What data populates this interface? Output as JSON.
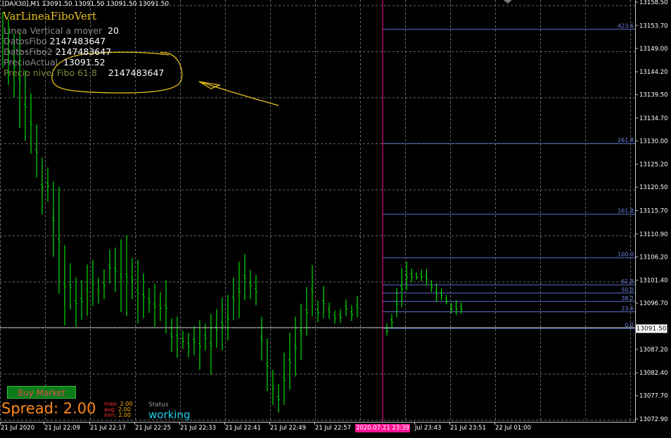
{
  "header": {
    "symbol_line": "[DAX30],M1  13091.50 13091.50 13091.50 13091.50"
  },
  "indicator": {
    "title": "VarLineaFiboVert",
    "rows": [
      {
        "label": "Linea Vertical a mover",
        "value": "20"
      },
      {
        "label": "DatosFibo",
        "value": "2147483647"
      },
      {
        "label": "DatosFibo2",
        "value": "2147483647"
      },
      {
        "label": "PrecioActual",
        "value": "13091.52"
      },
      {
        "label": "Precio nivel Fibo 61.8",
        "value": "2147483647"
      }
    ]
  },
  "panel": {
    "buy_button": "Buy Market",
    "spread_label": "Spread: 2.00",
    "max_label": "max:",
    "max_value": "2.00",
    "avg_label": "avg:",
    "avg_value": "2.00",
    "min_label": "min:",
    "min_value": "2.00",
    "status_label": "Status",
    "status_value": "working"
  },
  "axis": {
    "price_ticks": [
      "13158.50",
      "13153.70",
      "13149.00",
      "13144.20",
      "13139.50",
      "13134.70",
      "13130.00",
      "13125.20",
      "13120.50",
      "13115.70",
      "13110.90",
      "13106.20",
      "13101.40",
      "13096.70",
      "13091.50",
      "13087.20",
      "13082.40",
      "13077.70",
      "13072.90"
    ],
    "current_price": "13091.50",
    "time_ticks": [
      "21 Jul 2020",
      "21 Jul 22:09",
      "21 Jul 22:17",
      "21 Jul 22:25",
      "21 Jul 22:33",
      "21 Jul 22:41",
      "21 Jul 22:49",
      "21 Jul 22:57",
      "Jul 23:43",
      "21 Jul 23:51",
      "22 Jul 01:00"
    ],
    "highlight_time": "2020.07.21 23:39"
  },
  "fibo": {
    "levels": [
      "423.6",
      "261.8",
      "161.8",
      "100.0",
      "61.8",
      "50.0",
      "38.2",
      "23.6",
      "0.0"
    ],
    "line_color": "#5a6fc8",
    "label_color": "#6f86e6"
  },
  "colors": {
    "candle": "#00e000",
    "grid": "#6a6a6a",
    "vline": "#ff1493",
    "annotation": "#e7c21d"
  },
  "chart_data": {
    "type": "candlestick",
    "ylim": [
      13072.9,
      13158.5
    ],
    "bars": [
      {
        "t": "21 Jul 22:02",
        "h": 13156.5,
        "l": 13145.0
      },
      {
        "t": "21 Jul 22:03",
        "h": 13155.0,
        "l": 13141.5
      },
      {
        "t": "21 Jul 22:04",
        "h": 13152.0,
        "l": 13139.0
      },
      {
        "t": "21 Jul 22:05",
        "h": 13152.3,
        "l": 13132.6
      },
      {
        "t": "21 Jul 22:06",
        "h": 13144.5,
        "l": 13130.0
      },
      {
        "t": "21 Jul 22:07",
        "h": 13139.8,
        "l": 13127.4
      },
      {
        "t": "21 Jul 22:08",
        "h": 13133.4,
        "l": 13122.5
      },
      {
        "t": "21 Jul 22:09",
        "h": 13126.6,
        "l": 13114.9
      },
      {
        "t": "21 Jul 22:10",
        "h": 13124.6,
        "l": 13117.5
      },
      {
        "t": "21 Jul 22:11",
        "h": 13121.7,
        "l": 13106.2
      },
      {
        "t": "21 Jul 22:12",
        "h": 13120.6,
        "l": 13098.6
      },
      {
        "t": "21 Jul 22:13",
        "h": 13108.6,
        "l": 13092.1
      },
      {
        "t": "21 Jul 22:14",
        "h": 13104.9,
        "l": 13095.4
      },
      {
        "t": "21 Jul 22:15",
        "h": 13102.0,
        "l": 13091.8
      },
      {
        "t": "21 Jul 22:16",
        "h": 13101.4,
        "l": 13093.3
      },
      {
        "t": "21 Jul 22:17",
        "h": 13104.6,
        "l": 13094.1
      },
      {
        "t": "21 Jul 22:18",
        "h": 13105.6,
        "l": 13096.1
      },
      {
        "t": "21 Jul 22:19",
        "h": 13102.0,
        "l": 13096.6
      },
      {
        "t": "21 Jul 22:20",
        "h": 13103.6,
        "l": 13097.5
      },
      {
        "t": "21 Jul 22:21",
        "h": 13107.7,
        "l": 13100.7
      },
      {
        "t": "21 Jul 22:22",
        "h": 13108.1,
        "l": 13099.0
      },
      {
        "t": "21 Jul 22:23",
        "h": 13109.8,
        "l": 13094.9
      },
      {
        "t": "21 Jul 22:24",
        "h": 13110.6,
        "l": 13094.1
      },
      {
        "t": "21 Jul 22:25",
        "h": 13106.0,
        "l": 13097.5
      },
      {
        "t": "21 Jul 22:26",
        "h": 13105.6,
        "l": 13092.5
      },
      {
        "t": "21 Jul 22:27",
        "h": 13102.8,
        "l": 13093.6
      },
      {
        "t": "21 Jul 22:28",
        "h": 13099.8,
        "l": 13094.7
      },
      {
        "t": "21 Jul 22:29",
        "h": 13100.7,
        "l": 13091.8
      },
      {
        "t": "21 Jul 22:30",
        "h": 13098.9,
        "l": 13093.0
      },
      {
        "t": "21 Jul 22:31",
        "h": 13101.4,
        "l": 13090.5
      },
      {
        "t": "21 Jul 22:32",
        "h": 13093.5,
        "l": 13086.7
      },
      {
        "t": "21 Jul 22:33",
        "h": 13093.9,
        "l": 13085.5
      },
      {
        "t": "21 Jul 22:34",
        "h": 13091.0,
        "l": 13087.3
      },
      {
        "t": "21 Jul 22:35",
        "h": 13090.6,
        "l": 13085.6
      },
      {
        "t": "21 Jul 22:36",
        "h": 13092.0,
        "l": 13086.0
      },
      {
        "t": "21 Jul 22:37",
        "h": 13093.2,
        "l": 13083.0
      },
      {
        "t": "21 Jul 22:38",
        "h": 13092.5,
        "l": 13087.0
      },
      {
        "t": "21 Jul 22:39",
        "h": 13094.5,
        "l": 13082.0
      },
      {
        "t": "21 Jul 22:40",
        "h": 13095.5,
        "l": 13087.5
      },
      {
        "t": "21 Jul 22:41",
        "h": 13097.8,
        "l": 13087.0
      },
      {
        "t": "21 Jul 22:42",
        "h": 13098.4,
        "l": 13089.0
      },
      {
        "t": "21 Jul 22:43",
        "h": 13102.0,
        "l": 13093.2
      },
      {
        "t": "21 Jul 22:44",
        "h": 13105.2,
        "l": 13093.6
      },
      {
        "t": "21 Jul 22:45",
        "h": 13106.8,
        "l": 13097.3
      },
      {
        "t": "21 Jul 22:46",
        "h": 13103.5,
        "l": 13097.5
      },
      {
        "t": "21 Jul 22:47",
        "h": 13102.5,
        "l": 13096.2
      },
      {
        "t": "21 Jul 22:48",
        "h": 13093.9,
        "l": 13084.9
      },
      {
        "t": "21 Jul 22:49",
        "h": 13089.4,
        "l": 13078.6
      },
      {
        "t": "21 Jul 22:50",
        "h": 13083.0,
        "l": 13075.8
      },
      {
        "t": "21 Jul 22:51",
        "h": 13080.1,
        "l": 13074.2
      },
      {
        "t": "21 Jul 22:52",
        "h": 13086.5,
        "l": 13075.8
      },
      {
        "t": "21 Jul 22:53",
        "h": 13090.6,
        "l": 13078.9
      },
      {
        "t": "21 Jul 22:54",
        "h": 13093.9,
        "l": 13081.6
      },
      {
        "t": "21 Jul 22:55",
        "h": 13096.6,
        "l": 13085.0
      },
      {
        "t": "21 Jul 22:56",
        "h": 13100.0,
        "l": 13090.0
      },
      {
        "t": "21 Jul 22:57",
        "h": 13104.5,
        "l": 13094.0
      },
      {
        "t": "21 Jul 22:58",
        "h": 13097.2,
        "l": 13092.8
      },
      {
        "t": "21 Jul 22:59",
        "h": 13100.2,
        "l": 13093.6
      },
      {
        "t": "21 Jul 23:00",
        "h": 13096.8,
        "l": 13093.5
      },
      {
        "t": "21 Jul 23:01",
        "h": 13095.2,
        "l": 13092.5
      },
      {
        "t": "21 Jul 23:02",
        "h": 13095.5,
        "l": 13092.6
      },
      {
        "t": "21 Jul 23:03",
        "h": 13097.5,
        "l": 13094.0
      },
      {
        "t": "21 Jul 23:04",
        "h": 13096.2,
        "l": 13093.0
      },
      {
        "t": "21 Jul 23:05",
        "h": 13098.2,
        "l": 13093.8
      },
      {
        "t": "21 Jul 23:39",
        "h": 13092.5,
        "l": 13090.0
      },
      {
        "t": "21 Jul 23:40",
        "h": 13094.5,
        "l": 13091.5
      },
      {
        "t": "21 Jul 23:41",
        "h": 13099.8,
        "l": 13093.8
      },
      {
        "t": "21 Jul 23:42",
        "h": 13103.9,
        "l": 13095.9
      },
      {
        "t": "21 Jul 23:43",
        "h": 13105.2,
        "l": 13099.3
      },
      {
        "t": "21 Jul 23:44",
        "h": 13103.8,
        "l": 13101.0
      },
      {
        "t": "21 Jul 23:45",
        "h": 13103.0,
        "l": 13101.5
      },
      {
        "t": "21 Jul 23:46",
        "h": 13103.6,
        "l": 13101.2
      },
      {
        "t": "21 Jul 23:47",
        "h": 13103.7,
        "l": 13100.3
      },
      {
        "t": "21 Jul 23:48",
        "h": 13101.4,
        "l": 13099.0
      },
      {
        "t": "21 Jul 23:49",
        "h": 13100.7,
        "l": 13096.9
      },
      {
        "t": "21 Jul 23:50",
        "h": 13099.7,
        "l": 13097.3
      },
      {
        "t": "21 Jul 23:51",
        "h": 13098.4,
        "l": 13096.4
      },
      {
        "t": "21 Jul 23:52",
        "h": 13096.8,
        "l": 13094.6
      },
      {
        "t": "21 Jul 23:53",
        "h": 13097.3,
        "l": 13094.2
      },
      {
        "t": "21 Jul 23:54",
        "h": 13096.8,
        "l": 13094.5
      }
    ]
  }
}
